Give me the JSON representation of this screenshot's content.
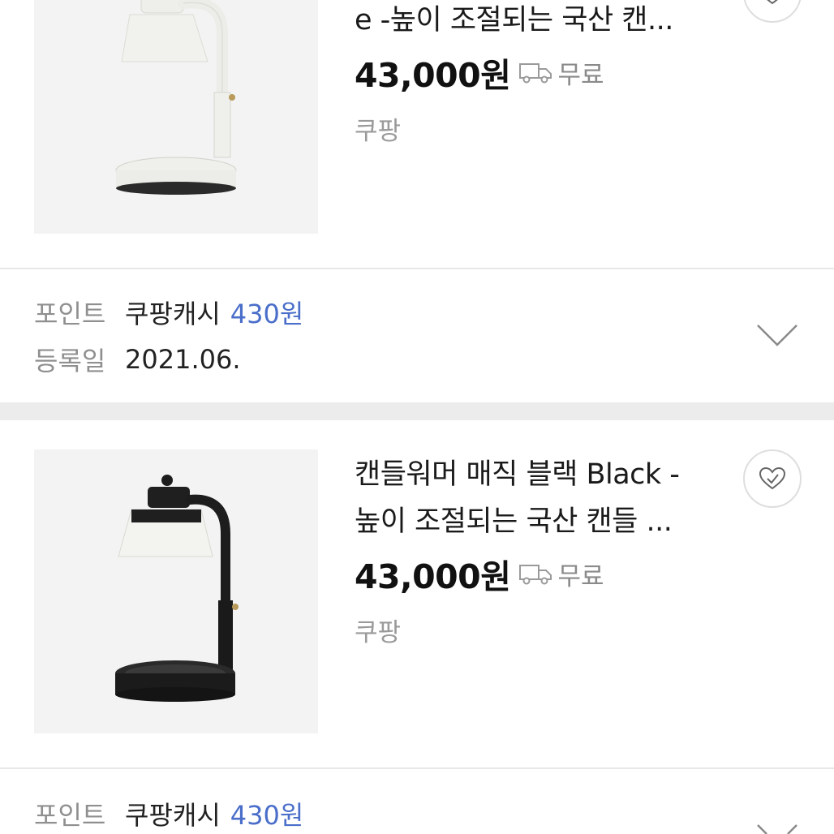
{
  "items": [
    {
      "title_lines": [
        "e -높이 조절되는 국산 캔..."
      ],
      "price": "43,000원",
      "shipping": "무료",
      "store": "쿠팡",
      "lamp_color": "white",
      "points_label": "포인트",
      "points_name": "쿠팡캐시",
      "points_value": "430원",
      "registered_label": "등록일",
      "registered_value": "2021.06."
    },
    {
      "title_lines": [
        "캔들워머 매직 블랙 Black -",
        "높이 조절되는 국산 캔들 ..."
      ],
      "price": "43,000원",
      "shipping": "무료",
      "store": "쿠팡",
      "lamp_color": "black",
      "points_label": "포인트",
      "points_name": "쿠팡캐시",
      "points_value": "430원"
    }
  ],
  "icons": {
    "truck": "truck-icon",
    "heart": "heart-check-icon",
    "chevron": "chevron-down-icon"
  },
  "colors": {
    "accent": "#4a6ec9",
    "muted": "#8f8f8f",
    "divider": "#e7e7e7",
    "section_gap": "#ececec"
  }
}
